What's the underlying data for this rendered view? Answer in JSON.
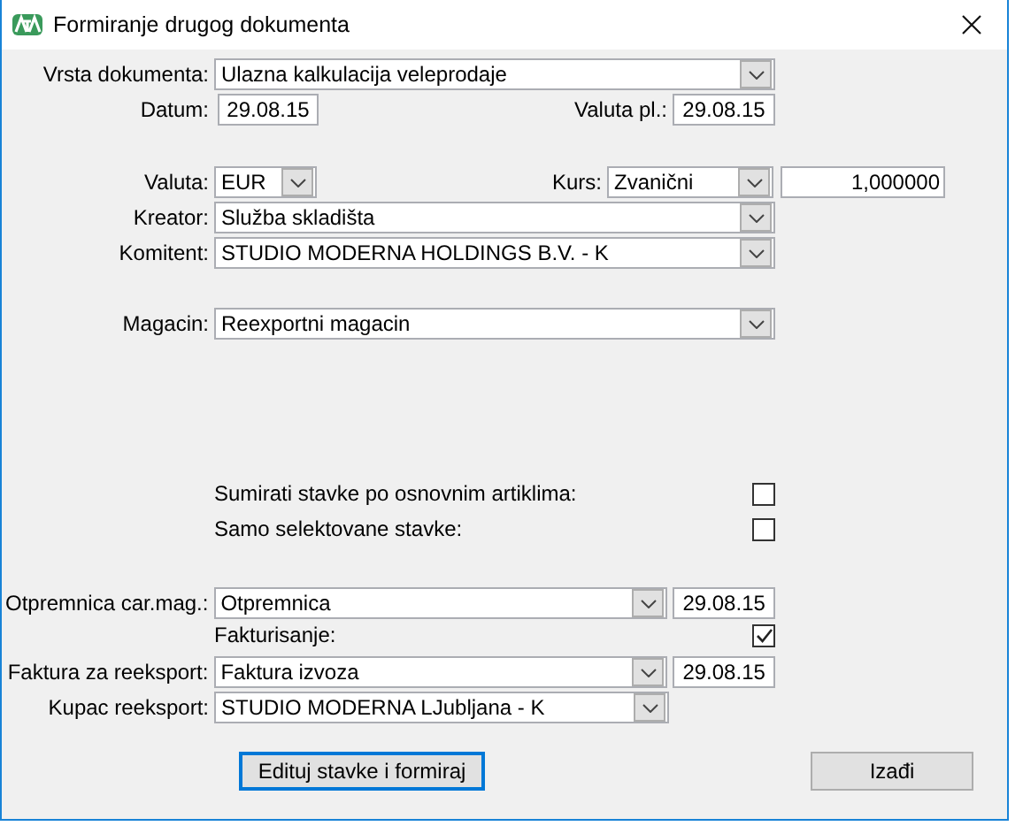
{
  "window": {
    "title": "Formiranje drugog dokumenta"
  },
  "document_type": {
    "label": "Vrsta dokumenta:",
    "value": "Ulazna kalkulacija veleprodaje"
  },
  "datum": {
    "label": "Datum:",
    "value": "29.08.15"
  },
  "valuta_pl": {
    "label": "Valuta pl.:",
    "value": "29.08.15"
  },
  "valuta": {
    "label": "Valuta:",
    "value": "EUR"
  },
  "kurs": {
    "label": "Kurs:",
    "value": "Zvanični",
    "rate": "1,000000"
  },
  "kreator": {
    "label": "Kreator:",
    "value": "Služba skladišta"
  },
  "komitent": {
    "label": "Komitent:",
    "value": "STUDIO MODERNA HOLDINGS B.V. - K"
  },
  "magacin": {
    "label": "Magacin:",
    "value": "Reexportni magacin"
  },
  "options": [
    {
      "label": "Sumirati stavke po osnovnim artiklima:",
      "checked": false
    },
    {
      "label": "Samo selektovane stavke:",
      "checked": false
    }
  ],
  "otpremnica": {
    "label": "Otpremnica car.mag.:",
    "value": "Otpremnica",
    "date": "29.08.15"
  },
  "fakturisanje": {
    "label": "Fakturisanje:",
    "checked": true
  },
  "faktura": {
    "label": "Faktura za reeksport:",
    "value": "Faktura izvoza",
    "date": "29.08.15"
  },
  "kupac": {
    "label": "Kupac reeksport:",
    "value": "STUDIO MODERNA LJubljana - K"
  },
  "buttons": [
    {
      "label": "Edituj stavke i formiraj",
      "focused": true
    },
    {
      "label": "Izađi",
      "focused": false
    }
  ]
}
